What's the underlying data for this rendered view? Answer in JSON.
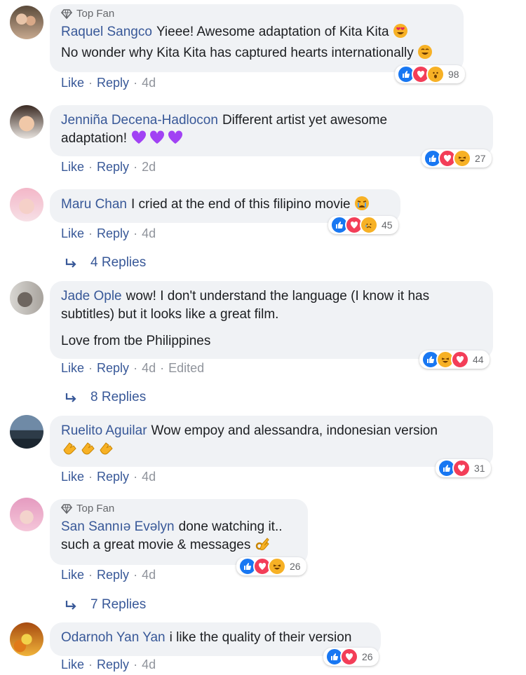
{
  "comments": [
    {
      "top_fan": "Top Fan",
      "author": "Raquel Sangco",
      "line1": "Yieee! Awesome adaptation of Kita Kita",
      "line2": "No wonder why Kita Kita has captured hearts internationally",
      "like": "Like",
      "reply": "Reply",
      "time": "4d",
      "reaction_count": "98"
    },
    {
      "author": "Jenniña Decena-Hadlocon",
      "line1": "Different artist yet awesome",
      "line2": "adaptation!",
      "like": "Like",
      "reply": "Reply",
      "time": "2d",
      "reaction_count": "27"
    },
    {
      "author": "Maru Chan",
      "line1": "I cried at the end of this filipino movie",
      "like": "Like",
      "reply": "Reply",
      "time": "4d",
      "reaction_count": "45",
      "replies": "4 Replies"
    },
    {
      "author": "Jade Ople",
      "line1": "wow! I don't understand the language (I know it has",
      "line2": "subtitles) but it looks like a great film.",
      "line3": "Love from tbe Philippines",
      "like": "Like",
      "reply": "Reply",
      "time": "4d",
      "edited": "Edited",
      "reaction_count": "44",
      "replies": "8 Replies"
    },
    {
      "author": "Ruelito Aguilar",
      "line1": "Wow empoy and alessandra, indonesian version",
      "like": "Like",
      "reply": "Reply",
      "time": "4d",
      "reaction_count": "31"
    },
    {
      "top_fan": "Top Fan",
      "author": "San Sannıə Evəlyn",
      "line1": "done watching it..",
      "line2": "such a great movie & messages",
      "like": "Like",
      "reply": "Reply",
      "time": "4d",
      "reaction_count": "26",
      "replies": "7 Replies"
    },
    {
      "author": "Odarnoh Yan Yan",
      "line1": "i like the quality of their version",
      "like": "Like",
      "reply": "Reply",
      "time": "4d",
      "reaction_count": "26"
    }
  ],
  "colors": {
    "link": "#385898",
    "bubble": "#f0f2f5",
    "like": "#1877f2",
    "love": "#f33e58",
    "emoji": "#f7b125"
  }
}
